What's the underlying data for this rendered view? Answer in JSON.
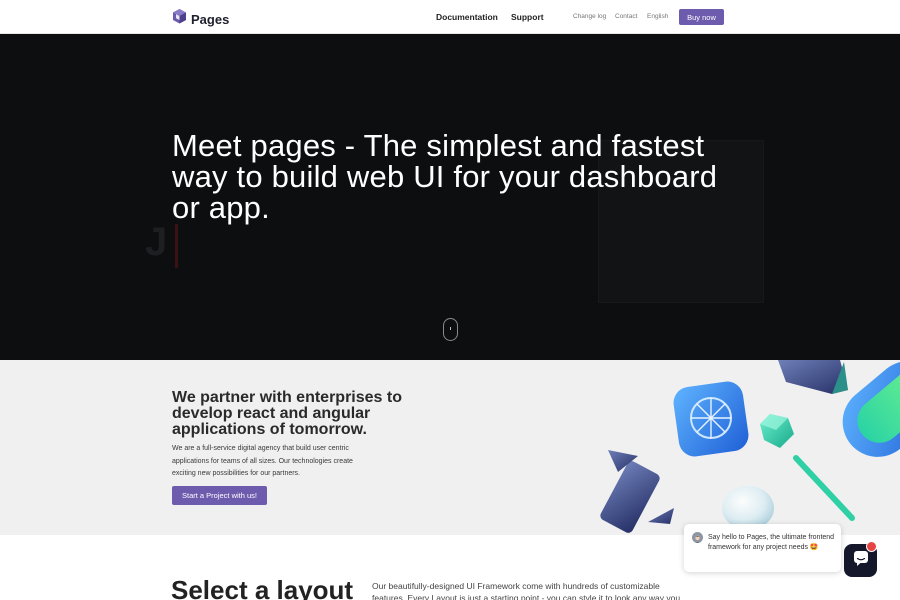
{
  "header": {
    "brand": "Pages",
    "nav_main": [
      "Documentation",
      "Support"
    ],
    "nav_small": [
      "Change log",
      "Contact",
      "English"
    ],
    "buy_label": "Buy now"
  },
  "hero": {
    "title": "Meet pages - The simplest and fastest way to build web UI for your dashboard or app."
  },
  "partner": {
    "heading": "We partner with enterprises to develop react and angular applications of tomorrow.",
    "text": "We are a full-service digital agency that build user centric applications for teams of all sizes. Our technologies create exciting new possibilities for our partners.",
    "cta_label": "Start a Project with us!"
  },
  "layout_section": {
    "title": "Select a layout",
    "text": "Our beautifully-designed UI Framework come with hundreds of customizable features. Every Layout is just a starting point - you can style it to look any way you"
  },
  "chat": {
    "message": "Say hello to Pages, the ultimate frontend framework for any project needs 🤩"
  },
  "colors": {
    "accent": "#6d5cae",
    "hero_bg": "#0d0e10",
    "partner_bg": "#f0f0f0",
    "chat_launcher": "#15172b",
    "chat_badge": "#e84343"
  },
  "icons": {
    "logo": "cube-logo-icon",
    "scroll": "scroll-mouse-icon",
    "chat": "chat-bubble-icon"
  }
}
